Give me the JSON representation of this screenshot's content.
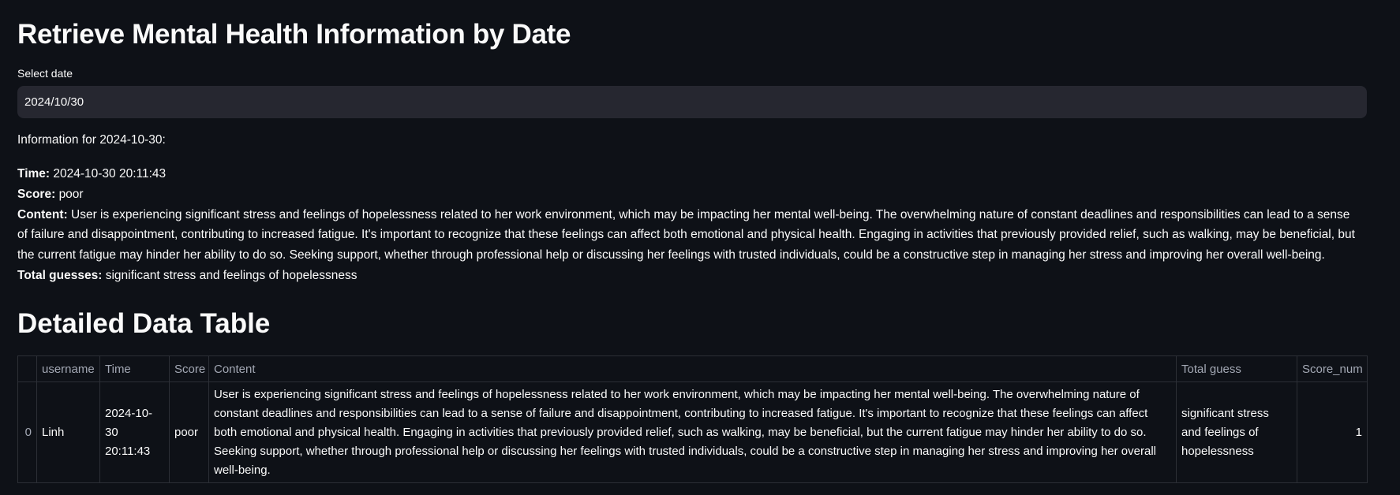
{
  "title": "Retrieve Mental Health Information by Date",
  "date_picker": {
    "label": "Select date",
    "value": "2024/10/30"
  },
  "info": {
    "heading": "Information for 2024-10-30:",
    "time_label": "Time:",
    "time_value": "2024-10-30 20:11:43",
    "score_label": "Score:",
    "score_value": "poor",
    "content_label": "Content:",
    "content_value": "User is experiencing significant stress and feelings of hopelessness related to her work environment, which may be impacting her mental well-being. The overwhelming nature of constant deadlines and responsibilities can lead to a sense of failure and disappointment, contributing to increased fatigue. It's important to recognize that these feelings can affect both emotional and physical health. Engaging in activities that previously provided relief, such as walking, may be beneficial, but the current fatigue may hinder her ability to do so. Seeking support, whether through professional help or discussing her feelings with trusted individuals, could be a constructive step in managing her stress and improving her overall well-being.",
    "guesses_label": "Total guesses:",
    "guesses_value": "significant stress and feelings of hopelessness"
  },
  "table": {
    "title": "Detailed Data Table",
    "columns": [
      "",
      "username",
      "Time",
      "Score",
      "Content",
      "Total guess",
      "Score_num"
    ],
    "rows": [
      {
        "index": "0",
        "username": "Linh",
        "time": "2024-10-30 20:11:43",
        "score": "poor",
        "content": "User is experiencing significant stress and feelings of hopelessness related to her work environment, which may be impacting her mental well-being. The overwhelming nature of constant deadlines and responsibilities can lead to a sense of failure and disappointment, contributing to increased fatigue. It's important to recognize that these feelings can affect both emotional and physical health. Engaging in activities that previously provided relief, such as walking, may be beneficial, but the current fatigue may hinder her ability to do so. Seeking support, whether through professional help or discussing her feelings with trusted individuals, could be a constructive step in managing her stress and improving her overall well-being.",
        "total_guess": "significant stress and feelings of hopelessness",
        "score_num": "1"
      }
    ]
  }
}
